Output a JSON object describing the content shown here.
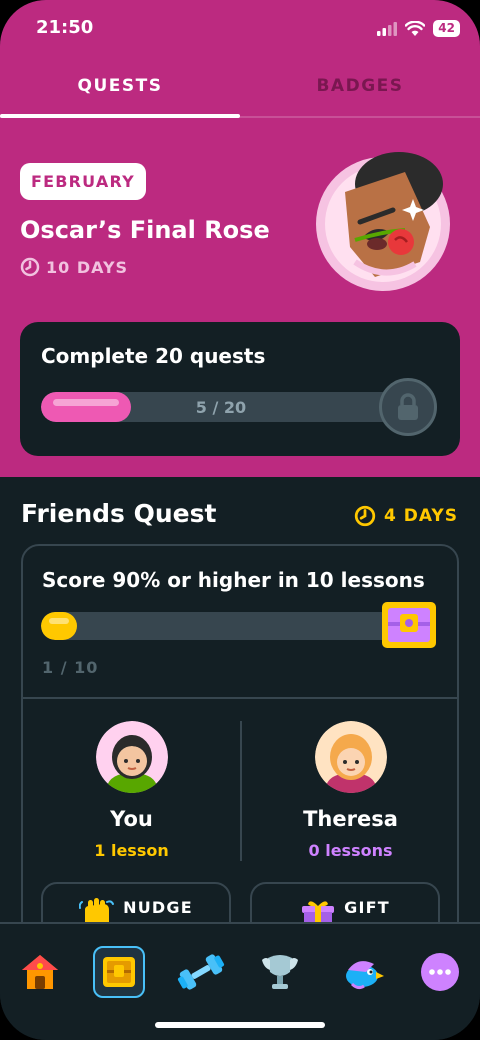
{
  "status_bar": {
    "time": "21:50",
    "battery": "42"
  },
  "tabs": [
    {
      "label": "QUESTS",
      "active": true
    },
    {
      "label": "BADGES",
      "active": false
    }
  ],
  "monthly_quest": {
    "month_badge": "FEBRUARY",
    "title": "Oscar’s Final Rose",
    "days_left": "10 DAYS",
    "challenge": "Complete 20 quests",
    "progress_text": "5 / 20",
    "progress": {
      "current": 5,
      "total": 20
    }
  },
  "friends_quest": {
    "title": "Friends Quest",
    "days_left": "4 DAYS",
    "goal": "Score 90% or higher in 10 lessons",
    "progress_text": "1 / 10",
    "progress": {
      "current": 1,
      "total": 10
    },
    "friends": [
      {
        "name": "You",
        "stat": "1 lesson",
        "stat_color": "#ffc800"
      },
      {
        "name": "Theresa",
        "stat": "0 lessons",
        "stat_color": "#ce82ff"
      }
    ],
    "actions": [
      {
        "label": "NUDGE",
        "icon": "waving-hand-icon"
      },
      {
        "label": "GIFT",
        "icon": "gift-icon"
      }
    ]
  },
  "bottom_nav": [
    {
      "icon": "home-icon",
      "active": false
    },
    {
      "icon": "quests-chest-icon",
      "active": true
    },
    {
      "icon": "practice-dumbbell-icon",
      "active": false
    },
    {
      "icon": "league-trophy-icon",
      "active": false
    },
    {
      "icon": "shop-bird-icon",
      "active": false
    },
    {
      "icon": "more-icon",
      "active": false
    }
  ],
  "colors": {
    "brand_pink": "#bc2a80",
    "background": "#131f24",
    "progress_pink": "#ee59b3",
    "progress_yellow": "#ffc800",
    "accent_blue": "#49c0f8",
    "accent_purple": "#ce82ff"
  }
}
